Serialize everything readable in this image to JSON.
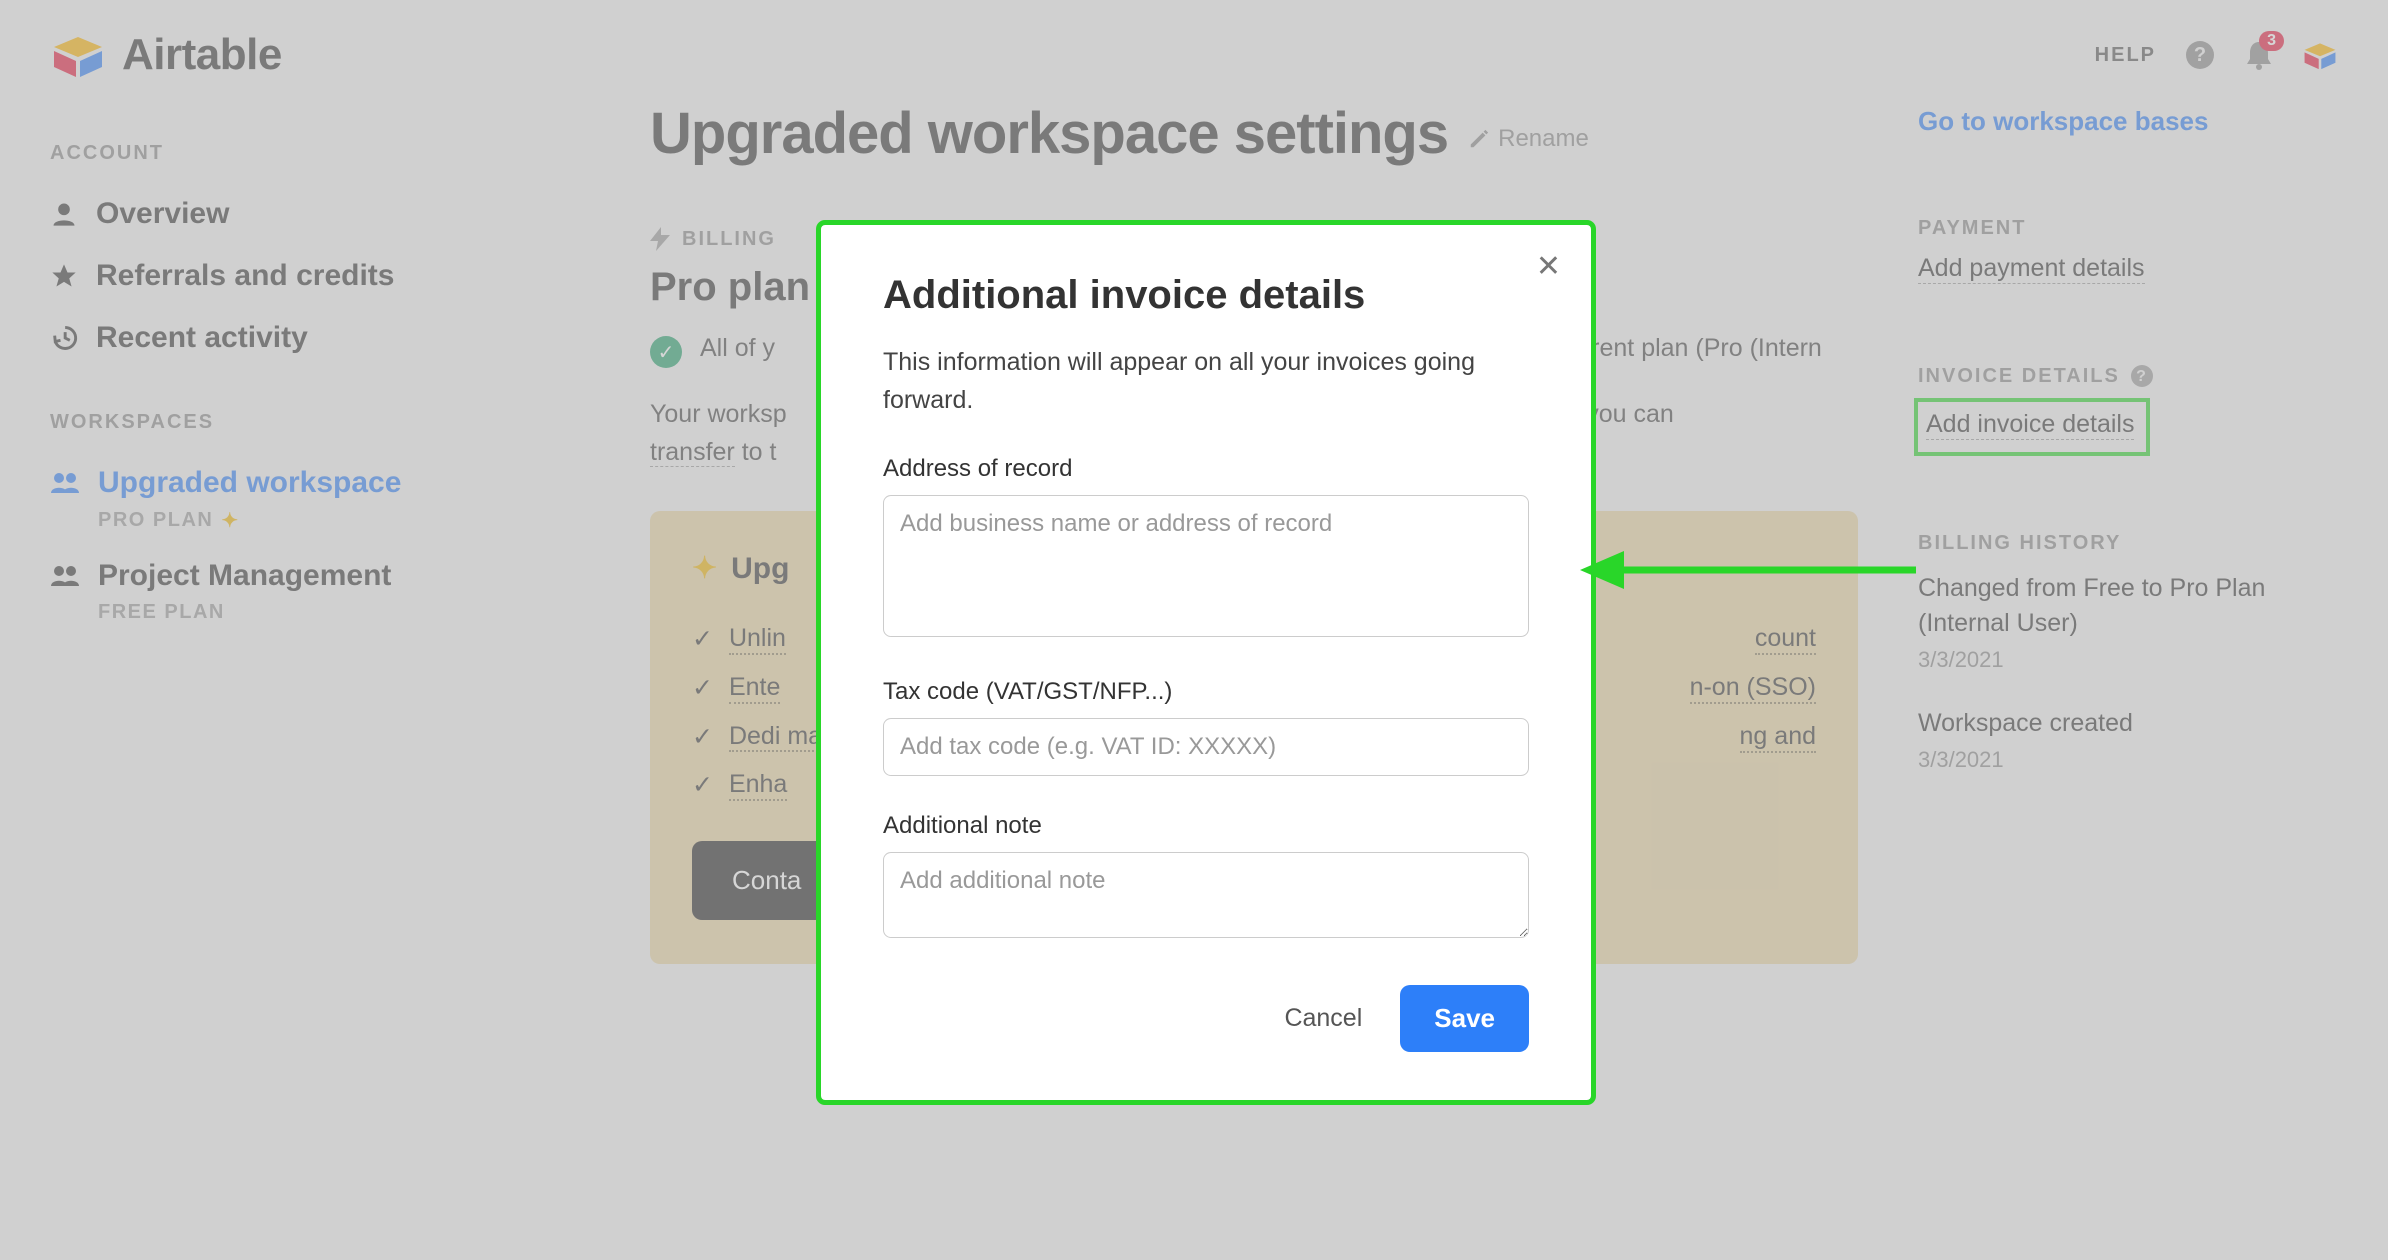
{
  "brand": {
    "name": "Airtable"
  },
  "topbar": {
    "help_label": "HELP",
    "notification_count": "3"
  },
  "sidebar": {
    "account_label": "ACCOUNT",
    "items": [
      {
        "label": "Overview"
      },
      {
        "label": "Referrals and credits"
      },
      {
        "label": "Recent activity"
      }
    ],
    "workspaces_label": "WORKSPACES",
    "ws": [
      {
        "label": "Upgraded workspace",
        "plan": "PRO PLAN"
      },
      {
        "label": "Project Management",
        "plan": "FREE PLAN"
      }
    ]
  },
  "main": {
    "page_title": "Upgraded workspace settings",
    "rename_label": "Rename",
    "billing_label": "BILLING",
    "plan_name": "Pro plan",
    "status_prefix": "All of y",
    "status_suffix": "urrent plan (Pro (Intern",
    "paragraph_a": "Your worksp",
    "paragraph_b": "hat you can ",
    "paragraph_c": "transfer",
    "paragraph_d": " to t",
    "upgrade_title": "Upg",
    "features": [
      "Unlin",
      "Ente",
      "Dedi mana",
      "Enha"
    ],
    "features_right": [
      "count",
      "n-on (SSO)",
      "ng and"
    ],
    "contact_label": "Conta"
  },
  "right": {
    "goto_label": "Go to workspace bases",
    "payment_label": "PAYMENT",
    "payment_link": "Add payment details",
    "invoice_label": "INVOICE DETAILS",
    "invoice_link": "Add invoice details",
    "history_label": "BILLING HISTORY",
    "history": [
      {
        "text": "Changed from Free to Pro Plan (Internal User)",
        "date": "3/3/2021"
      },
      {
        "text": "Workspace created",
        "date": "3/3/2021"
      }
    ]
  },
  "modal": {
    "title": "Additional invoice details",
    "desc": "This information will appear on all your invoices going forward.",
    "addr_label": "Address of record",
    "addr_placeholder": "Add business name or address of record",
    "tax_label": "Tax code (VAT/GST/NFP...)",
    "tax_placeholder": "Add tax code (e.g. VAT ID: XXXXX)",
    "note_label": "Additional note",
    "note_placeholder": "Add additional note",
    "cancel": "Cancel",
    "save": "Save"
  }
}
